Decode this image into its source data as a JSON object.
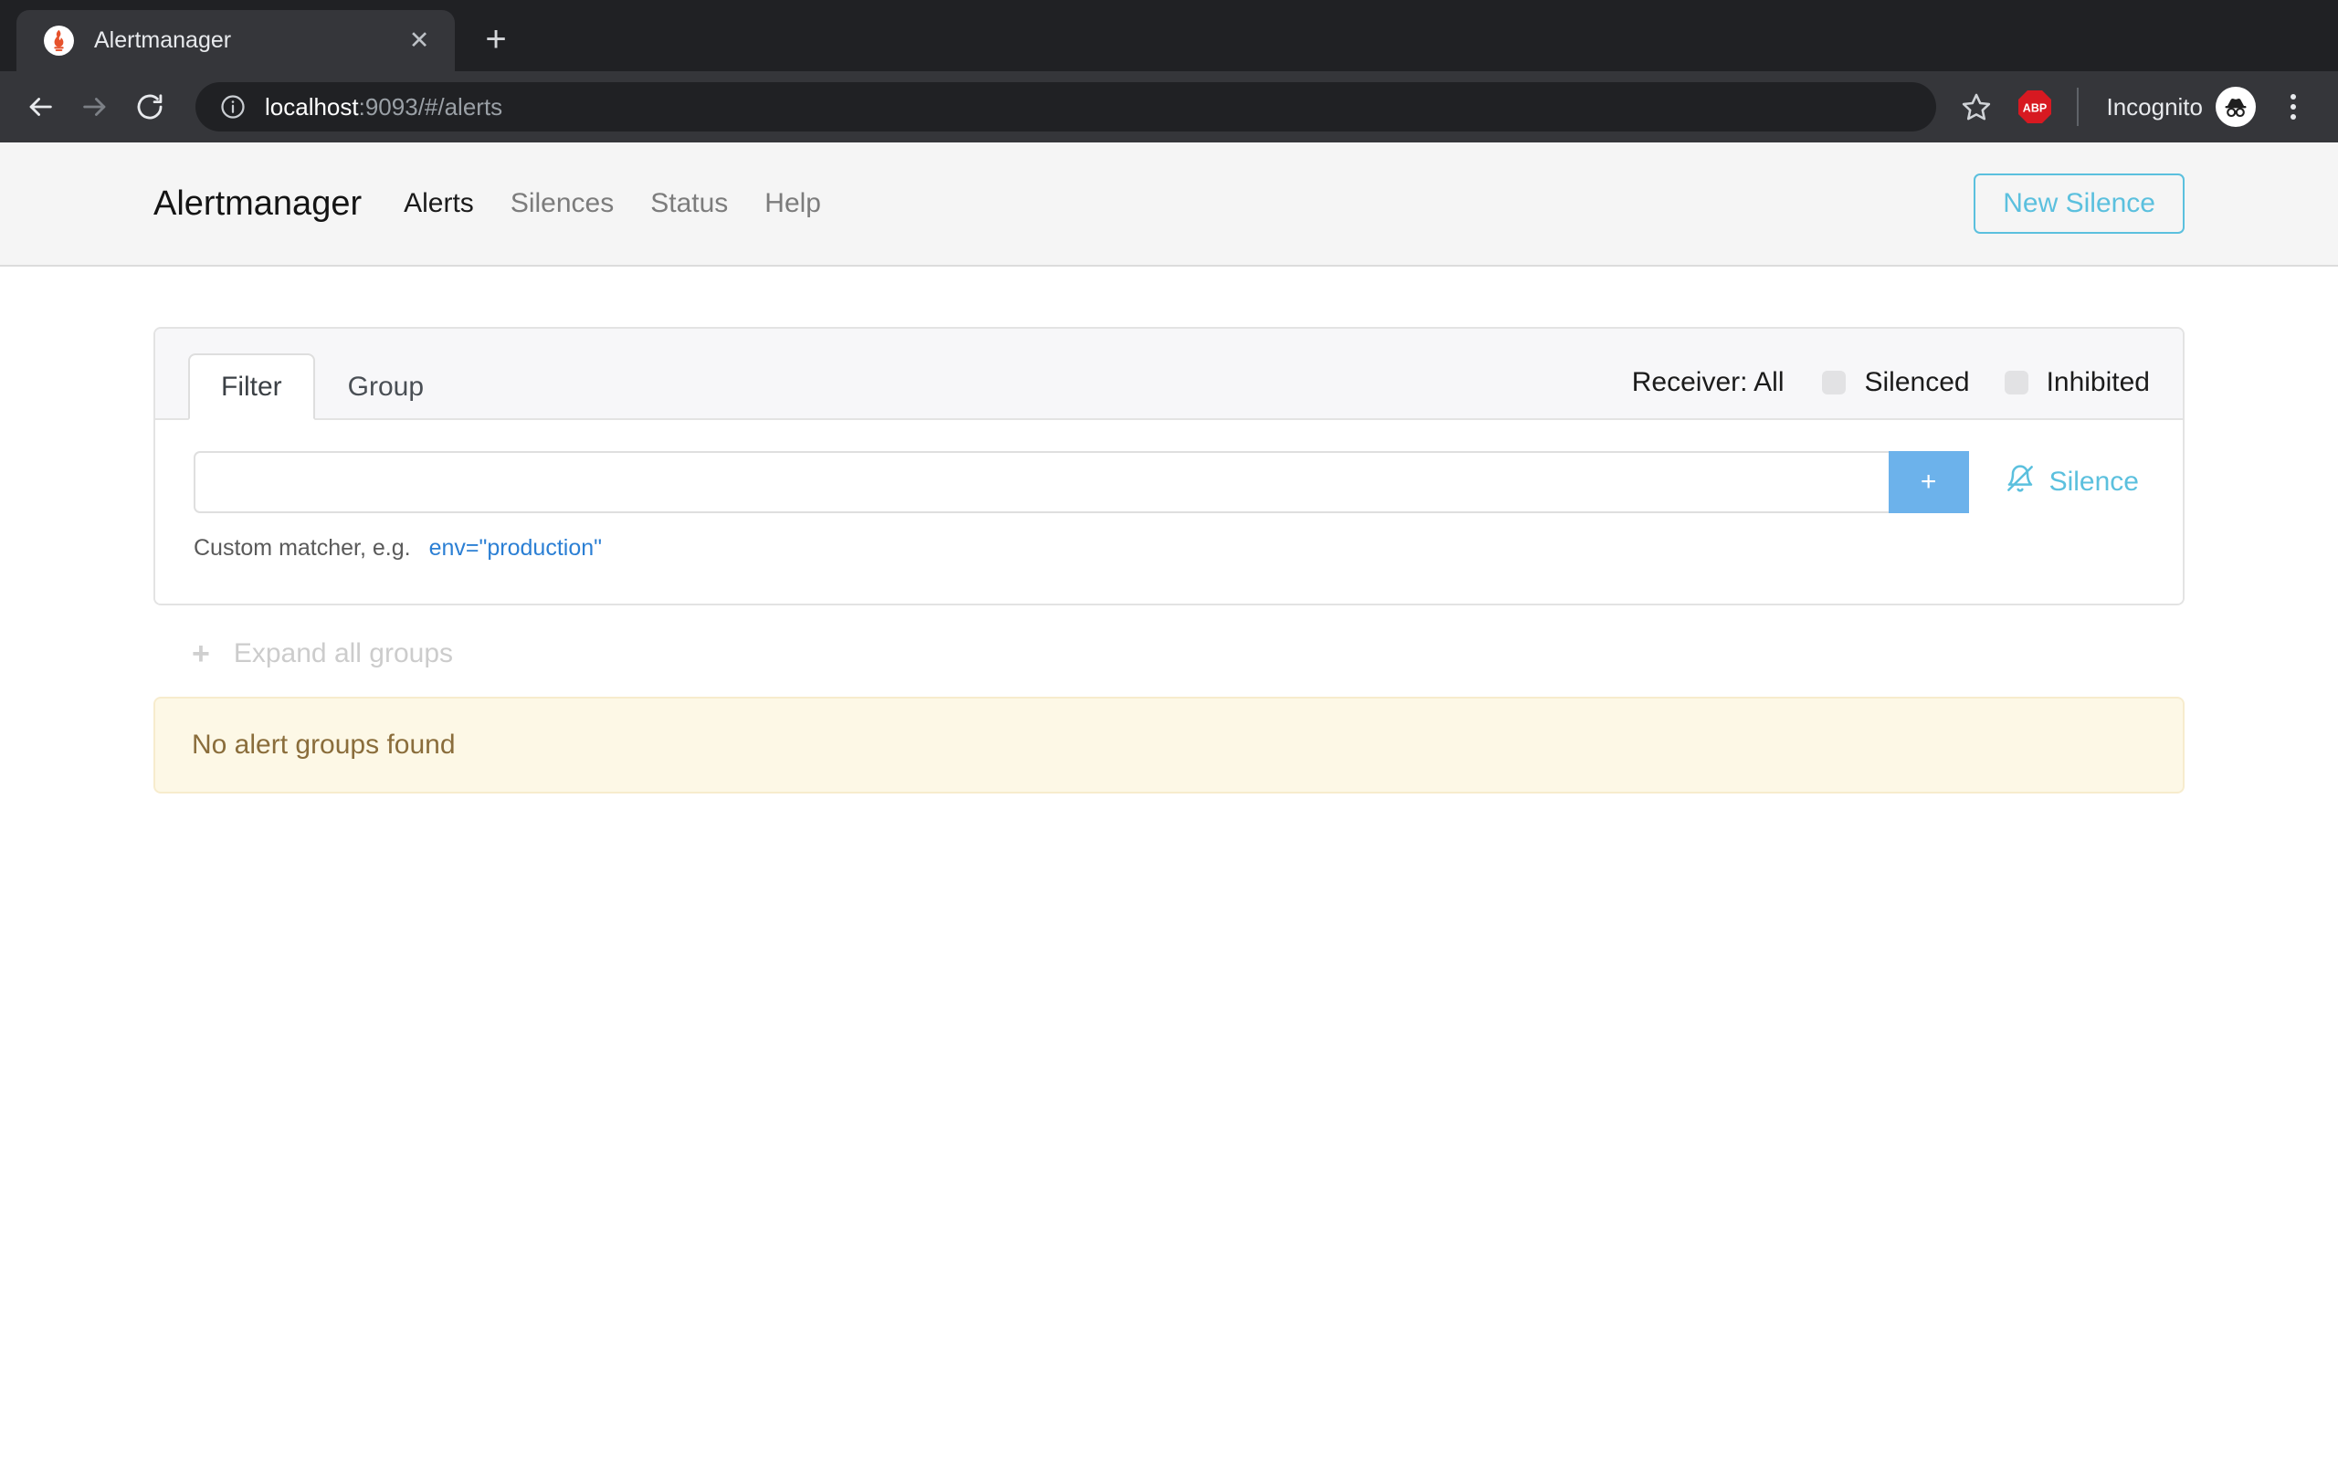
{
  "browser": {
    "tab": {
      "title": "Alertmanager",
      "favicon": "prometheus-flame-icon",
      "close_label": "✕"
    },
    "new_tab_label": "+",
    "omnibox": {
      "host": "localhost",
      "path": ":9093/#/alerts",
      "full_url": "localhost:9093/#/alerts",
      "security_icon": "info-circle-icon"
    },
    "extensions": {
      "abp_label": "ABP"
    },
    "profile": {
      "label": "Incognito",
      "icon": "incognito-spy-icon"
    },
    "menu_label": "⋮"
  },
  "navbar": {
    "brand": "Alertmanager",
    "links": [
      {
        "label": "Alerts",
        "active": true
      },
      {
        "label": "Silences",
        "active": false
      },
      {
        "label": "Status",
        "active": false
      },
      {
        "label": "Help",
        "active": false
      }
    ],
    "new_silence_button": "New Silence"
  },
  "filter_card": {
    "tabs": [
      {
        "label": "Filter",
        "active": true
      },
      {
        "label": "Group",
        "active": false
      }
    ],
    "receiver": {
      "label": "Receiver: All",
      "value": "All"
    },
    "toggles": [
      {
        "label": "Silenced",
        "checked": false
      },
      {
        "label": "Inhibited",
        "checked": false
      }
    ],
    "matcher_input": {
      "value": "",
      "placeholder": ""
    },
    "add_button": "+",
    "silence_link": {
      "label": "Silence",
      "icon": "bell-slash-icon"
    },
    "help": {
      "prefix": "Custom matcher, e.g.",
      "example": "env=\"production\""
    }
  },
  "groups": {
    "expand_all_label": "Expand all groups",
    "expand_icon": "plus-icon",
    "empty_message": "No alert groups found"
  },
  "colors": {
    "accent_info": "#5bc0de",
    "accent_primary": "#6cb2eb",
    "link_blue": "#2b7fd4",
    "warning_bg": "#fdf8e6",
    "warning_text": "#8a6d3b",
    "chrome_dark": "#202124",
    "chrome_toolbar": "#35363a",
    "navbar_bg": "#f5f5f5"
  }
}
